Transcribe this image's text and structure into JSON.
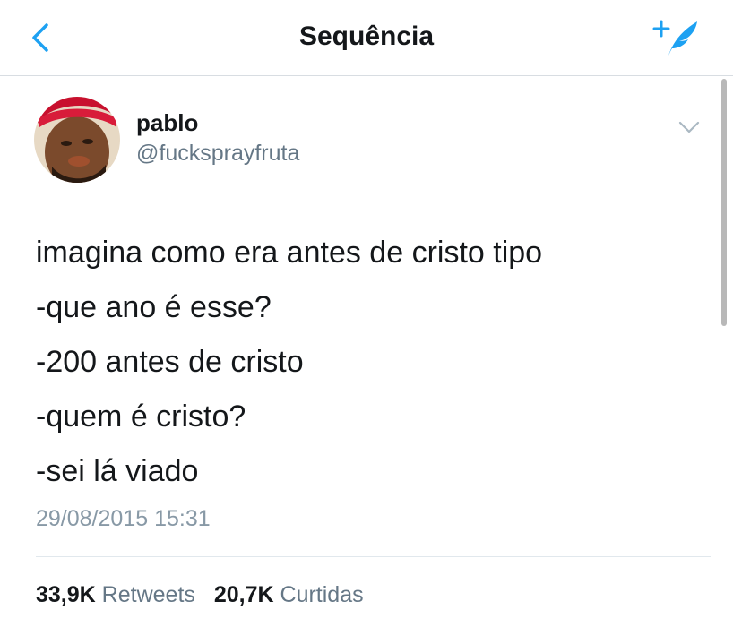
{
  "header": {
    "title": "Sequência",
    "back_icon": "chevron-left-icon",
    "compose_icon": "compose-tweet-icon",
    "accent_color": "#1da1f2"
  },
  "tweet": {
    "author_name": "pablo",
    "author_handle": "@fucksprayfruta",
    "avatar_icon": "avatar",
    "menu_icon": "chevron-down-icon",
    "lines": [
      "imagina como era antes de cristo tipo",
      "-que ano é esse?",
      "-200 antes de cristo",
      "-quem é cristo?",
      "-sei lá viado"
    ],
    "timestamp": "29/08/2015 15:31"
  },
  "stats": {
    "retweets_count": "33,9K",
    "retweets_label": "Retweets",
    "likes_count": "20,7K",
    "likes_label": "Curtidas"
  }
}
